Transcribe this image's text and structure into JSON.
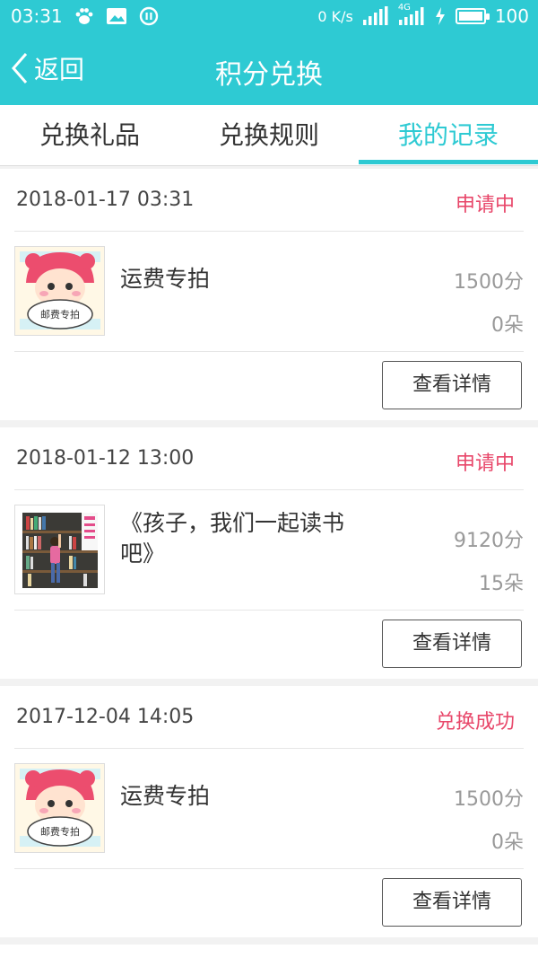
{
  "status_bar": {
    "time": "03:31",
    "net_speed": "0 K/s",
    "network": "4G",
    "battery": "100"
  },
  "nav": {
    "back_label": "返回",
    "title": "积分兑换"
  },
  "tabs": [
    {
      "label": "兑换礼品",
      "active": false
    },
    {
      "label": "兑换规则",
      "active": false
    },
    {
      "label": "我的记录",
      "active": true
    }
  ],
  "colors": {
    "accent": "#2ecad3",
    "status_pending": "#e8476a"
  },
  "records": [
    {
      "date": "2018-01-17 03:31",
      "status": "申请中",
      "product": "运费专拍",
      "points": "1500分",
      "flowers": "0朵",
      "thumb_text": "邮费专拍",
      "button": "查看详情"
    },
    {
      "date": "2018-01-12 13:00",
      "status": "申请中",
      "product": "《孩子，我们一起读书吧》",
      "points": "9120分",
      "flowers": "15朵",
      "thumb_text": "",
      "button": "查看详情"
    },
    {
      "date": "2017-12-04 14:05",
      "status": "兑换成功",
      "product": "运费专拍",
      "points": "1500分",
      "flowers": "0朵",
      "thumb_text": "邮费专拍",
      "button": "查看详情"
    }
  ]
}
